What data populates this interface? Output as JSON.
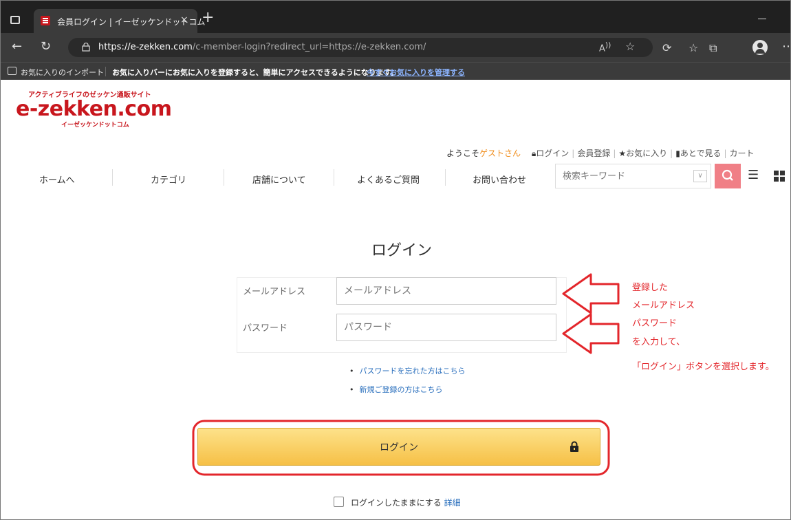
{
  "browser": {
    "tab_title": "会員ログイン | イーゼッケンドットコム",
    "tab_close": "×",
    "new_tab": "+",
    "url_domain": "https://e-zekken.com",
    "url_path": "/c-member-login?redirect_url=https://e-zekken.com/",
    "read_aloud": "A)",
    "favbar_import": "お気に入りのインポート",
    "favbar_message": "お気に入りバーにお気に入りを登録すると、簡単にアクセスできるようになります。",
    "favbar_link": "今すぐお気に入りを管理する"
  },
  "header": {
    "logo_tagline": "アクティブライフのゼッケン通販サイト",
    "logo_text": "e-zekken.com",
    "logo_subtitle": "イーゼッケンドットコム",
    "welcome_prefix": "ようこそ",
    "guest_name": "ゲストさん",
    "login_link": "ログイン",
    "register_link": "会員登録",
    "favorites_link": "お気に入り",
    "later_link": "あとで見る",
    "cart_link": "カート"
  },
  "nav": {
    "items": [
      "ホームへ",
      "カテゴリ",
      "店舗について",
      "よくあるご質問",
      "お問い合わせ"
    ],
    "search_placeholder": "検索キーワード"
  },
  "login": {
    "title": "ログイン",
    "email_label": "メールアドレス",
    "email_placeholder": "メールアドレス",
    "password_label": "パスワード",
    "password_placeholder": "パスワード",
    "forgot_password": "パスワードを忘れた方はこちら",
    "new_register": "新規ご登録の方はこちら",
    "login_button": "ログイン",
    "keep_login": "ログインしたままにする",
    "keep_detail": "詳細"
  },
  "annotation": {
    "lines": [
      "登録した",
      "メールアドレス",
      "パスワード",
      "を入力して、",
      "「ログイン」ボタンを選択します。"
    ],
    "color": "#e3262b"
  }
}
